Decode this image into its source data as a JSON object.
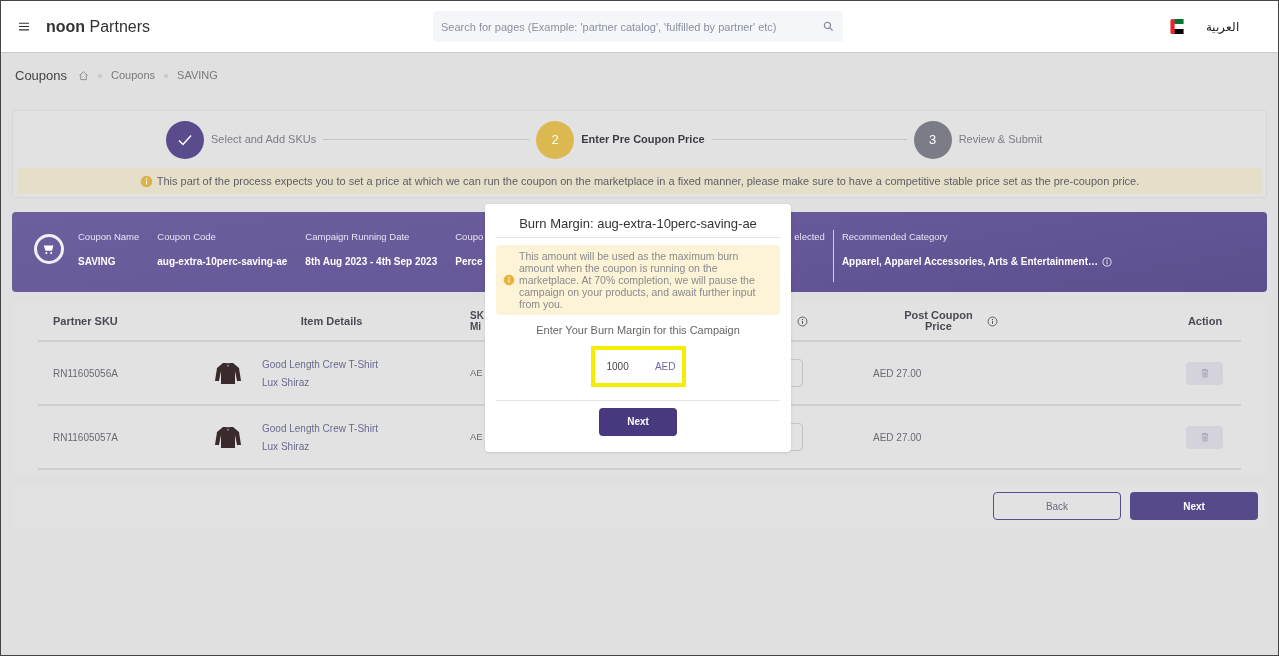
{
  "header": {
    "logo": "**noon** Partners",
    "search": {
      "placeholder": "Search for pages (Example: 'partner catalog', 'fulfilled by partner' etc)"
    },
    "language": "العربية"
  },
  "breadcrumb": {
    "title": "Coupons",
    "items": [
      "Coupons",
      "SAVING"
    ]
  },
  "stepper": {
    "steps": [
      {
        "label": "Select and Add SKUs",
        "kind": "done"
      },
      {
        "number": "2",
        "label": "Enter Pre Coupon Price",
        "kind": "active"
      },
      {
        "number": "3",
        "label": "Review & Submit",
        "kind": "pending"
      }
    ],
    "notice": "This part of the process expects you to set a price at which we can run the coupon on the marketplace in a fixed manner, please make sure to have a competitive stable price set as the pre-coupon price."
  },
  "coupon": {
    "fields": [
      {
        "label": "Coupon Name",
        "value": "SAVING"
      },
      {
        "label": "Coupon Code",
        "value": "aug-extra-10perc-saving-ae"
      },
      {
        "label": "Campaign Running Date",
        "value": "8th Aug 2023 - 4th Sep 2023"
      },
      {
        "label": "Coupo",
        "value": "Perce"
      },
      {
        "label": "elected"
      },
      {
        "label": "Recommended Category",
        "value": "Apparel, Apparel Accessories, Arts & Entertainment…",
        "info": true
      }
    ]
  },
  "table": {
    "columns": [
      "Partner SKU",
      "Item Details",
      "SK Mi",
      "",
      "Post Coupon Price",
      "Action"
    ],
    "rows": [
      {
        "sku": "RN11605056A",
        "name": "Good Length Crew T-Shirt",
        "brand": "Lux Shiraz",
        "column_3": "AE",
        "post_price": "AED 27.00"
      },
      {
        "sku": "RN11605057A",
        "name": "Good Length Crew T-Shirt",
        "brand": "Lux Shiraz",
        "column_3": "AE",
        "post_price": "AED 27.00"
      }
    ]
  },
  "footer": {
    "buttons": [
      {
        "label": "Back",
        "kind": "secondary"
      },
      {
        "label": "Next",
        "kind": "primary"
      }
    ]
  },
  "modal": {
    "title": "Burn Margin: aug-extra-10perc-saving-ae",
    "notice": "This amount will be used as the maximum burn amount when the coupon is running on the marketplace. At 70% completion, we will pause the campaign on your products, and await further input from you.",
    "prompt": "Enter Your Burn Margin for this Campaign",
    "field": {
      "value": "1000",
      "suffix": "AED"
    },
    "button": "Next"
  }
}
